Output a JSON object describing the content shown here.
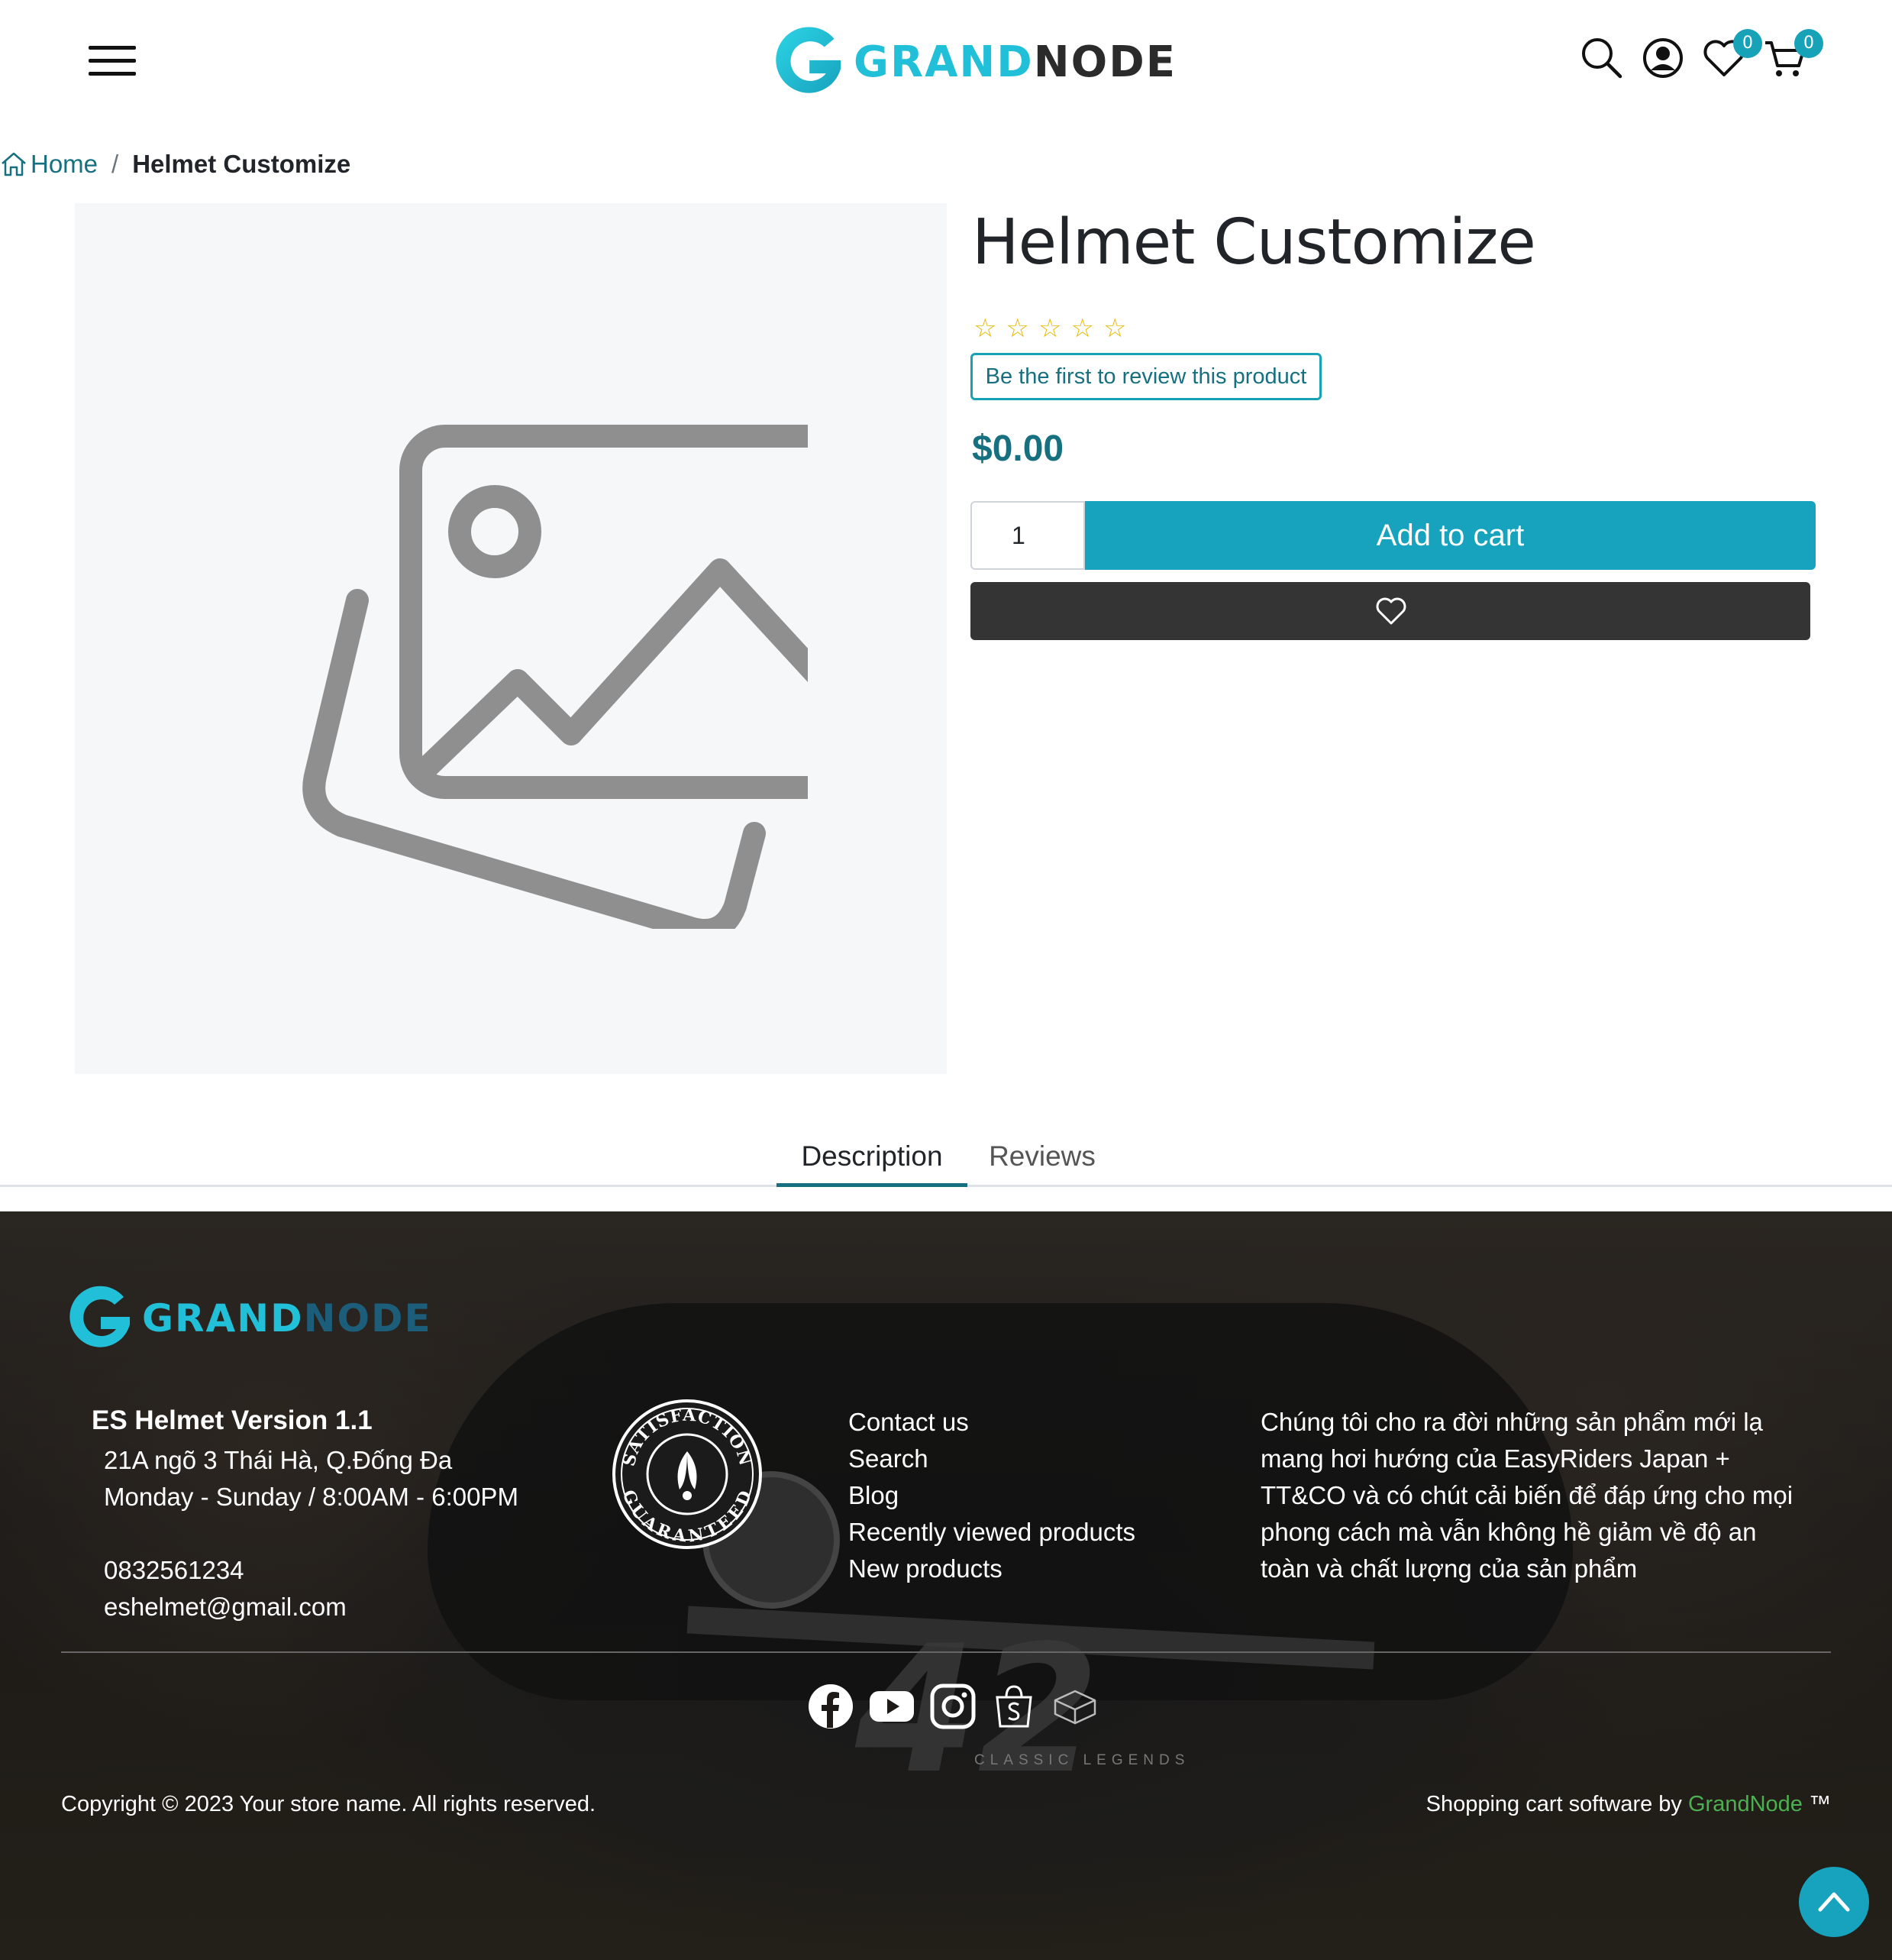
{
  "header": {
    "logo": {
      "part1": "GRAND",
      "part2": "NODE"
    },
    "wishlist_count": "0",
    "cart_count": "0",
    "icons": [
      "menu-icon",
      "search-icon",
      "account-icon",
      "heart-icon",
      "cart-icon"
    ]
  },
  "breadcrumb": {
    "home_label": "Home",
    "separator": "/",
    "current": "Helmet Customize"
  },
  "product": {
    "title": "Helmet Customize",
    "rating": 0,
    "rating_max": 5,
    "review_link": "Be the first to review this product",
    "price": "$0.00",
    "quantity": "1",
    "add_to_cart_label": "Add to cart",
    "image_icon": "image-placeholder-icon"
  },
  "tabs": [
    {
      "label": "Description",
      "active": true
    },
    {
      "label": "Reviews",
      "active": false
    }
  ],
  "footer": {
    "logo": {
      "part1": "GRAND",
      "part2": "NODE"
    },
    "store": {
      "name": "ES Helmet Version 1.1",
      "address": "21A ngõ 3 Thái Hà, Q.Đống Đa",
      "hours": "Monday - Sunday / 8:00AM - 6:00PM",
      "phone": "0832561234",
      "email": "eshelmet@gmail.com"
    },
    "seal": {
      "top_text": "SATISFACTION",
      "bottom_text": "GUARANTEED"
    },
    "links": [
      "Contact us",
      "Search",
      "Blog",
      "Recently viewed products",
      "New products"
    ],
    "about": "Chúng tôi cho ra đời những sản phẩm mới lạ mang hơi hướng của EasyRiders Japan + TT&CO và có chút cải biến để đáp ứng cho mọi phong cách mà vẫn không hề giảm về độ an toàn và chất lượng của sản phẩm",
    "socials": [
      "facebook-icon",
      "youtube-icon",
      "instagram-icon",
      "shopping-bag-icon",
      "box-icon"
    ],
    "background_text": {
      "number": "42",
      "brand": "CLASSIC LEGENDS"
    },
    "copyright": "Copyright © 2023 Your store name. All rights reserved.",
    "powered_prefix": "Shopping cart software by",
    "powered_link": "GrandNode",
    "powered_suffix": "™"
  },
  "colors": {
    "accent": "#17a2bd",
    "accent_dark": "#17707f",
    "star": "#e8b900",
    "dark_button": "#343434",
    "footer_link_green": "#4caf50"
  }
}
